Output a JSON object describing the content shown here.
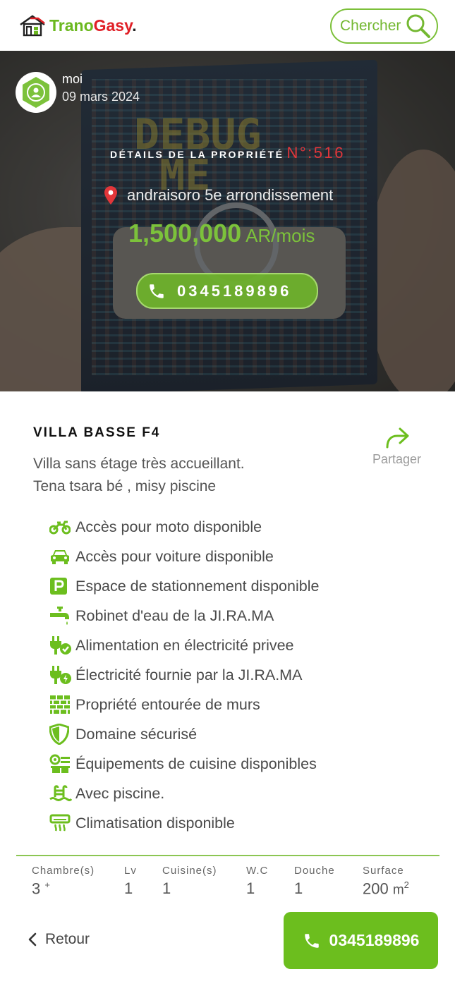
{
  "header": {
    "logo": {
      "part1": "Trano",
      "part2": "Gasy",
      "part3": "."
    },
    "search_label": "Chercher"
  },
  "hero": {
    "owner_name": "moi",
    "owner_date": "09 mars 2024",
    "details_label": "DÉTAILS DE LA PROPRIÉTÉ",
    "property_number": "N°:516",
    "address": "andraisoro 5e arrondissement",
    "price_amount": "1,500,000",
    "price_unit": "AR/mois",
    "phone": "0345189896"
  },
  "listing": {
    "title": "VILLA BASSE F4",
    "description_line1": "Villa sans étage très accueillant.",
    "description_line2": "Tena tsara bé , misy piscine",
    "share_label": "Partager"
  },
  "features": [
    {
      "icon": "motorcycle-icon",
      "label": "Accès pour moto disponible"
    },
    {
      "icon": "car-icon",
      "label": "Accès pour voiture disponible"
    },
    {
      "icon": "parking-icon",
      "label": "Espace de stationnement disponible"
    },
    {
      "icon": "faucet-icon",
      "label": "Robinet d'eau de la JI.RA.MA"
    },
    {
      "icon": "plug-check-icon",
      "label": "Alimentation en électricité privee"
    },
    {
      "icon": "plug-bolt-icon",
      "label": "Électricité fournie par la JI.RA.MA"
    },
    {
      "icon": "brick-wall-icon",
      "label": "Propriété entourée de murs"
    },
    {
      "icon": "shield-icon",
      "label": "Domaine sécurisé"
    },
    {
      "icon": "kitchen-icon",
      "label": "Équipements de cuisine disponibles"
    },
    {
      "icon": "pool-icon",
      "label": "Avec piscine."
    },
    {
      "icon": "air-conditioner-icon",
      "label": "Climatisation disponible"
    }
  ],
  "specs": {
    "chambres_label": "Chambre(s)",
    "chambres_value": "3",
    "chambres_plus": "+",
    "lv_label": "Lv",
    "lv_value": "1",
    "cuisine_label": "Cuisine(s)",
    "cuisine_value": "1",
    "wc_label": "W.C",
    "wc_value": "1",
    "douche_label": "Douche",
    "douche_value": "1",
    "surface_label": "Surface",
    "surface_value": "200",
    "surface_unit": "m",
    "surface_exp": "2"
  },
  "footer": {
    "back_label": "Retour",
    "call_number": "0345189896"
  },
  "colors": {
    "brand_green": "#6cbe1e",
    "brand_red": "#e01f26",
    "accent_red": "#e2363a"
  }
}
